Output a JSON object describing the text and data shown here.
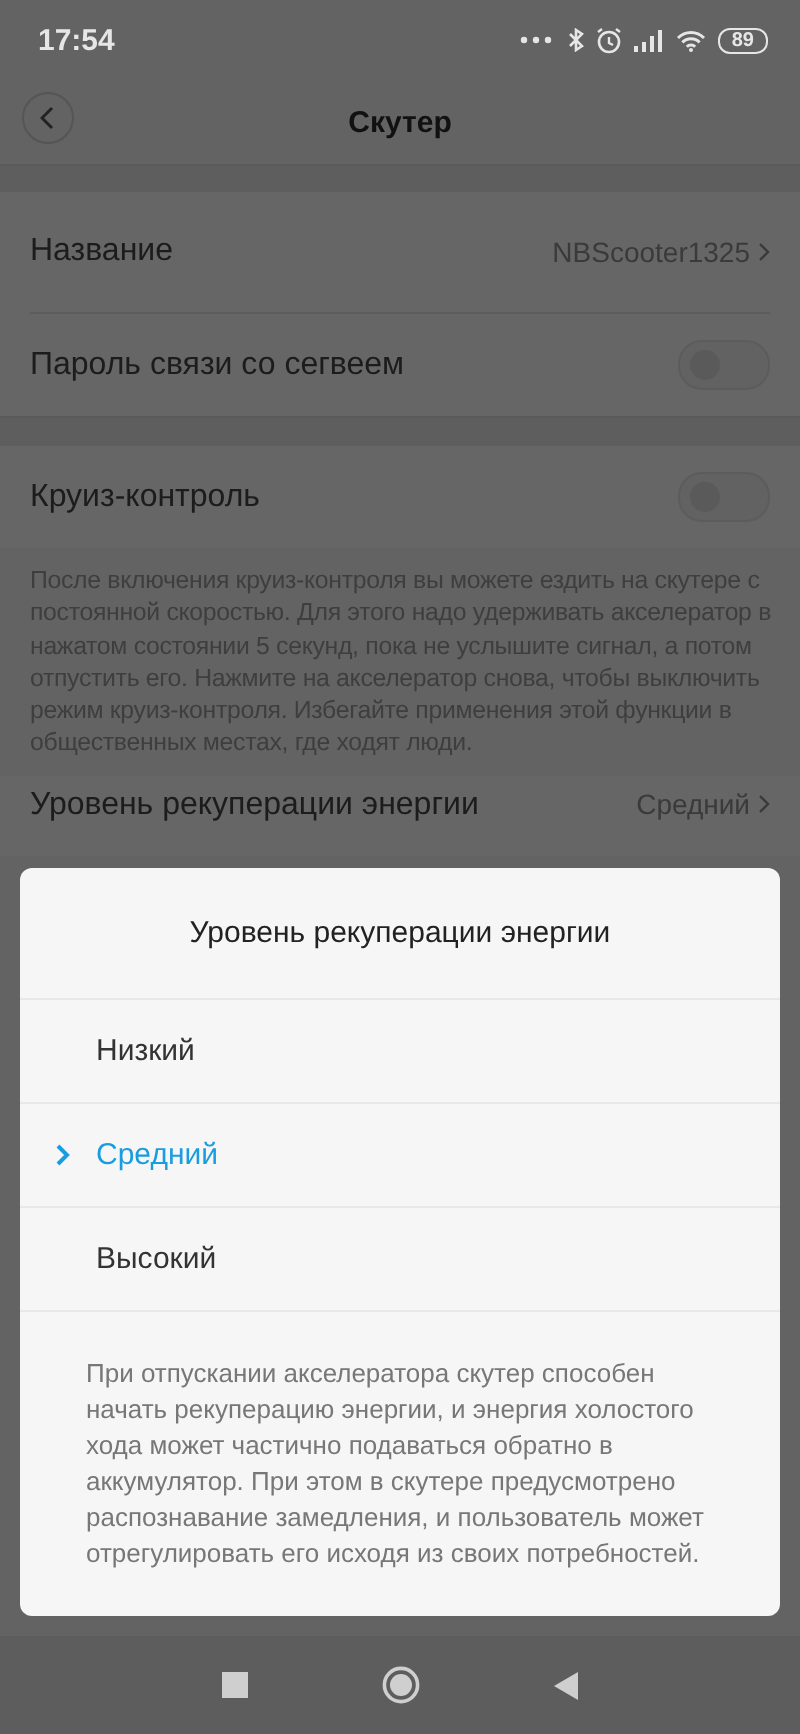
{
  "status_bar": {
    "time": "17:54",
    "battery": "89"
  },
  "header": {
    "title": "Скутер"
  },
  "settings": [
    {
      "kind": "value",
      "label": "Название",
      "value": "NBScooter1325"
    },
    {
      "kind": "switch",
      "label": "Пароль связи со сегвеем",
      "on": false
    }
  ],
  "cruise": {
    "label": "Круиз-контроль",
    "on": false,
    "description": "После включения круиз-контроля вы можете ездить на скутере с постоянной скоростью. Для этого надо удерживать акселератор в нажатом состоянии 5 секунд, пока не услышите сигнал, а потом отпустить его. Нажмите на акселератор снова, чтобы выключить режим круиз-контроля. Избегайте применения этой функции в общественных местах, где ходят люди."
  },
  "energy_row": {
    "label": "Уровень рекуперации энергии",
    "value": "Средний"
  },
  "dialog": {
    "title": "Уровень рекуперации энергии",
    "options": [
      {
        "label": "Низкий",
        "selected": false
      },
      {
        "label": "Средний",
        "selected": true
      },
      {
        "label": "Высокий",
        "selected": false
      }
    ],
    "description": "При отпускании акселератора скутер способен начать рекуперацию энергии, и энергия холостого хода может частично подаваться обратно в аккумулятор. При этом в скутере предусмотрено распознавание замедления, и пользователь может отрегулировать его исходя из своих потребностей."
  }
}
